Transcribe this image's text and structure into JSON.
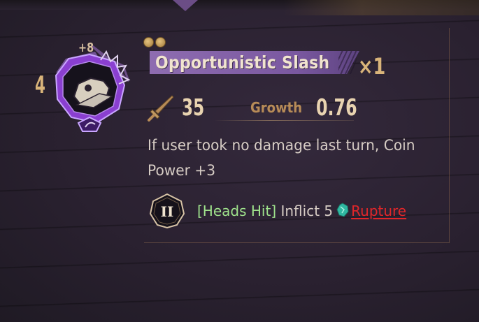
{
  "skill": {
    "level": "4",
    "offset": "+8",
    "name": "Opportunistic Slash",
    "multiplier": "1",
    "coin_count": 2,
    "icons": {
      "badge": "skill-badge-icon",
      "sword": "slash-attack-icon",
      "coin_slot": "coin-two-icon",
      "status": "rupture-icon"
    }
  },
  "stats": {
    "base_power": "35",
    "growth_label": "Growth",
    "growth_value": "0.76"
  },
  "description": {
    "line1": "If user took no damage last turn, Coin",
    "line2": "Power +3"
  },
  "coin_effect": {
    "coin_numeral": "II",
    "tag": "[Heads Hit]",
    "text": "Inflict 5",
    "keyword": "Rupture"
  },
  "colors": {
    "accent_purple": "#7a58a0",
    "gold": "#d9b47a",
    "heads_hit_green": "#9fe38c",
    "rupture_red": "#e0262a"
  }
}
